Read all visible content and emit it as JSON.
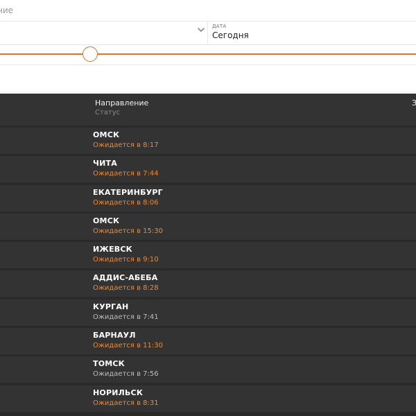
{
  "filter": {
    "top_label": "ние",
    "date_caption": "ДАТА",
    "date_value": "Сегодня"
  },
  "board": {
    "header": {
      "direction": "Направление",
      "status": "Статус",
      "right_fragment": "З"
    },
    "rows": [
      {
        "destination": "ОМСК",
        "status": "Ожидается в 8:17",
        "highlight": true
      },
      {
        "destination": "ЧИТА",
        "status": "Ожидается в 7:44",
        "highlight": true
      },
      {
        "destination": "ЕКАТЕРИНБУРГ",
        "status": "Ожидается в 8:06",
        "highlight": true
      },
      {
        "destination": "ОМСК",
        "status": "Ожидается в 15:30",
        "highlight": true
      },
      {
        "destination": "ИЖЕВСК",
        "status": "Ожидается в 9:10",
        "highlight": true
      },
      {
        "destination": "АДДИС-АБЕБА",
        "status": "Ожидается в 8:28",
        "highlight": true
      },
      {
        "destination": "КУРГАН",
        "status": "Ожидается в 7:41",
        "highlight": false
      },
      {
        "destination": "БАРНАУЛ",
        "status": "Ожидается в 11:30",
        "highlight": true
      },
      {
        "destination": "ТОМСК",
        "status": "Ожидается в 7:56",
        "highlight": false
      },
      {
        "destination": "НОРИЛЬСК",
        "status": "Ожидается в 8:31",
        "highlight": true
      }
    ]
  },
  "colors": {
    "accent": "#d47530",
    "delayed_text": "#e98a3c",
    "board_bg": "#2a2a2a",
    "row_bg": "#333333"
  }
}
